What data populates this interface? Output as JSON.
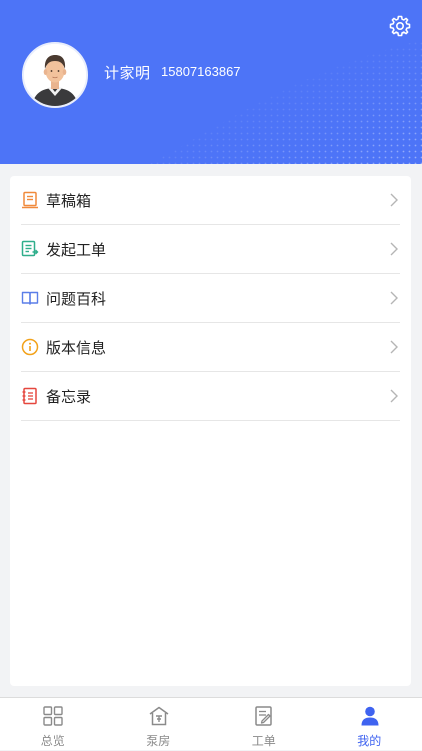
{
  "header": {
    "user_name": "计家明",
    "phone": "15807163867",
    "accent_color": "#4d74f7",
    "settings_icon": "gear-icon",
    "avatar_icon": "user-avatar"
  },
  "menu": {
    "items": [
      {
        "label": "草稿箱",
        "icon": "drafts-icon",
        "icon_color": "#f08a3c"
      },
      {
        "label": "发起工单",
        "icon": "create-workorder-icon",
        "icon_color": "#2fae8b"
      },
      {
        "label": "问题百科",
        "icon": "book-icon",
        "icon_color": "#5b7ee8"
      },
      {
        "label": "版本信息",
        "icon": "info-icon",
        "icon_color": "#f2a21a"
      },
      {
        "label": "备忘录",
        "icon": "memo-icon",
        "icon_color": "#e5473e"
      }
    ],
    "chevron_icon": "chevron-right-icon"
  },
  "tabbar": {
    "tabs": [
      {
        "label": "总览",
        "icon": "grid-icon",
        "active": false
      },
      {
        "label": "泵房",
        "icon": "pump-house-icon",
        "active": false
      },
      {
        "label": "工单",
        "icon": "workorder-icon",
        "active": false
      },
      {
        "label": "我的",
        "icon": "person-icon",
        "active": true
      }
    ],
    "active_color": "#3f63f0",
    "inactive_color": "#8a8a8a"
  }
}
